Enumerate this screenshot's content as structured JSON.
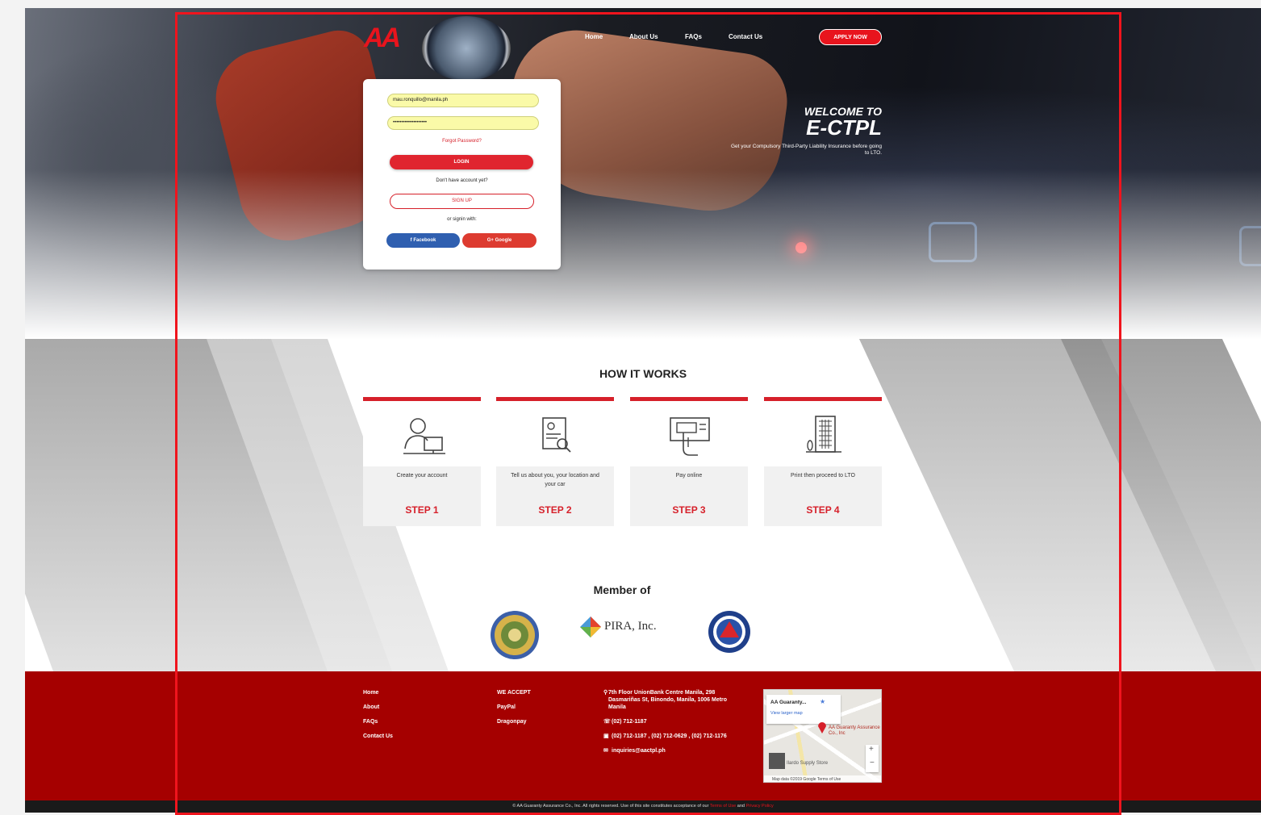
{
  "header": {
    "logo_text": "AA",
    "nav": [
      "Home",
      "About Us",
      "FAQs",
      "Contact Us"
    ],
    "apply_label": "APPLY NOW"
  },
  "hero": {
    "welcome_line1": "WELCOME TO",
    "welcome_line2": "E-CTPL",
    "tagline": "Get your Compulsory Third-Party Liability Insurance before going to LTO."
  },
  "login": {
    "email_value": "mau.ronquillo@manila.ph",
    "password_value": "••••••••••••••••••••",
    "forgot_label": "Forgot Password?",
    "login_label": "LOGIN",
    "no_account_text": "Don't have account yet?",
    "signup_label": "SIGN UP",
    "or_text": "or signin with:",
    "facebook_label": "f  Facebook",
    "google_label": "G+  Google"
  },
  "how_it_works": {
    "title": "HOW IT WORKS",
    "steps": [
      {
        "desc": "Create your account",
        "label": "STEP 1",
        "icon": "user-computer-icon"
      },
      {
        "desc": "Tell us about you, your location and your car",
        "label": "STEP 2",
        "icon": "id-search-icon"
      },
      {
        "desc": "Pay online",
        "label": "STEP 3",
        "icon": "atm-payment-icon"
      },
      {
        "desc": "Print then proceed to LTO",
        "label": "STEP 4",
        "icon": "building-icon"
      }
    ]
  },
  "members": {
    "title": "Member of",
    "logos": [
      {
        "icon": "seal-logo-icon"
      },
      {
        "name": "PIRA, Inc.",
        "icon": "pira-logo-icon"
      },
      {
        "icon": "ltms-logo-icon"
      }
    ]
  },
  "footer": {
    "links": [
      "Home",
      "About",
      "FAQs",
      "Contact Us"
    ],
    "accept_title": "WE ACCEPT",
    "accept_items": [
      "PayPal",
      "Dragonpay"
    ],
    "address": "7th Floor UnionBank Centre Manila, 298 Dasmariñas St, Binondo, Manila, 1006 Metro Manila",
    "phone": "(02) 712-1187",
    "fax": "(02) 712-1187 , (02) 712-0629 , (02) 712-1176",
    "email": "inquiries@aactpl.ph",
    "map": {
      "place": "AA Guaranty...",
      "view_larger": "View larger map",
      "pin_label": "AA Guaranty Assurance Co., Inc",
      "store_label": "Ilardo Supply Store",
      "attribution": "Map data ©2019 Google   Terms of Use"
    }
  },
  "bottom": {
    "copyright": "© AA Guaranty Assurance Co., Inc. All rights reserved. Use of this site constitutes acceptance of our ",
    "terms": "Terms of Use",
    "and": " and ",
    "privacy": "Privacy Policy"
  },
  "colors": {
    "brand_red": "#e8141d",
    "footer_red": "#a50000",
    "frame_red": "#f0141d"
  }
}
